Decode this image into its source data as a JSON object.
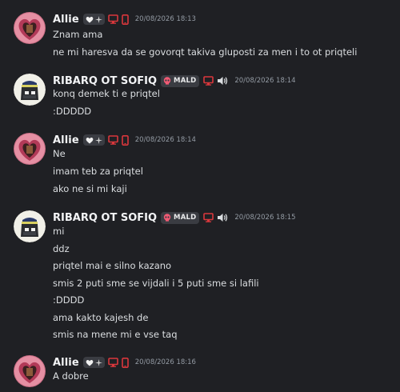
{
  "messages": [
    {
      "author": "Allie",
      "timestamp": "20/08/2026 18:13",
      "lines": [
        "Znam ama",
        "ne mi haresva da se govorqt takiva gluposti za men i to ot priqteli"
      ]
    },
    {
      "author": "RIBARQ OT SOFIQ",
      "badge": "MALD",
      "timestamp": "20/08/2026 18:14",
      "lines": [
        "konq demek ti e priqtel",
        ":DDDDD"
      ]
    },
    {
      "author": "Allie",
      "timestamp": "20/08/2026 18:14",
      "lines": [
        "Ne",
        "imam teb za priqtel",
        "ako ne si mi kaji"
      ]
    },
    {
      "author": "RIBARQ OT SOFIQ",
      "badge": "MALD",
      "timestamp": "20/08/2026 18:15",
      "lines": [
        "mi",
        "ddz",
        "priqtel mai e silno kazano",
        "smis 2 puti sme se vijdali i 5 puti sme si lafili",
        ":DDDD",
        "ama kakto kajesh de",
        "smis na mene mi e vse taq"
      ]
    },
    {
      "author": "Allie",
      "timestamp": "20/08/2026 18:16",
      "lines": [
        "A dobre"
      ]
    }
  ],
  "icons": {
    "allie": [
      "heart-badge-icon",
      "sparkle-icon",
      "desktop-red-icon",
      "mobile-red-icon"
    ],
    "ribarq": [
      "skull-icon",
      "desktop-red-icon",
      "speaker-icon"
    ]
  },
  "colors": {
    "background": "#1f2024",
    "username": "#f2f3f5",
    "text": "#dbdee1",
    "timestamp": "#949ba4",
    "status_red": "#da373c",
    "badge_bg": "#3a3c42"
  }
}
